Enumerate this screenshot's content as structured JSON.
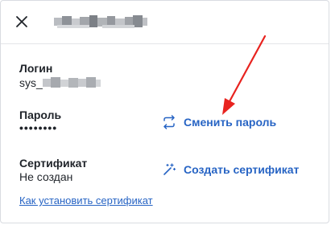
{
  "dialog": {
    "title_redacted": "sys_admin_user",
    "close_icon": "close-icon"
  },
  "login": {
    "label": "Логин",
    "value_visible": "sys_",
    "value_redacted": "admin01"
  },
  "password": {
    "label": "Пароль",
    "value": "••••••••",
    "action_label": "Сменить пароль",
    "action_icon": "swap-arrows-icon"
  },
  "certificate": {
    "label": "Сертификат",
    "value": "Не создан",
    "action_label": "Создать сертификат",
    "action_icon": "magic-wand-icon"
  },
  "help_link": "Как установить сертификат",
  "colors": {
    "accent": "#2764c4",
    "annotation_arrow": "#e8231f"
  }
}
